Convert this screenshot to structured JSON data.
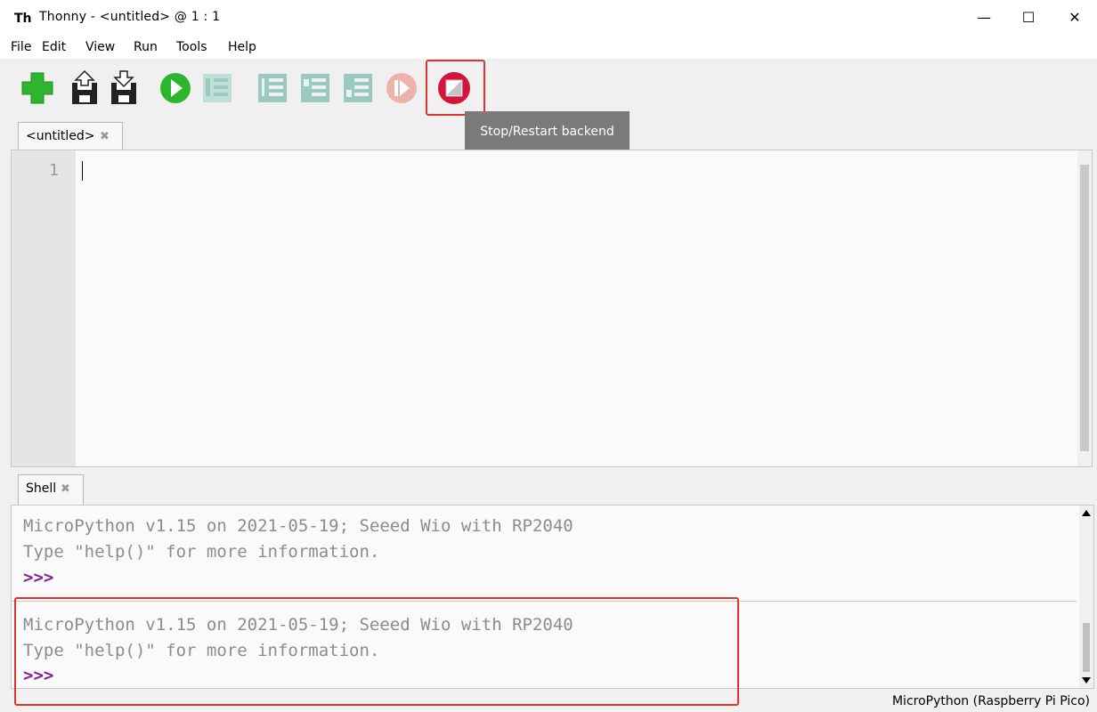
{
  "window": {
    "icon": "Th",
    "title": "Thonny  -  <untitled>  @  1 : 1",
    "minimize": "—",
    "maximize": "☐",
    "close": "✕"
  },
  "menu": {
    "items": [
      "File",
      "Edit",
      "View",
      "Run",
      "Tools",
      "Help"
    ]
  },
  "toolbar": {
    "buttons": [
      "new-file",
      "load-file",
      "save-file",
      "run",
      "debug",
      "step-over",
      "step-into",
      "step-out",
      "resume",
      "stop-restart"
    ],
    "tooltip": "Stop/Restart backend",
    "colors": {
      "green": "#2db52d",
      "stop_red": "#d6133a",
      "disabled": "#9bc8c0",
      "highlight": "#e5322d"
    }
  },
  "editor": {
    "tab_label": "<untitled>",
    "tab_close": "✖",
    "line_numbers": [
      "1"
    ]
  },
  "shell": {
    "tab_label": "Shell",
    "tab_close": "✖",
    "blocks": [
      {
        "line1": "MicroPython v1.15 on 2021-05-19; Seeed Wio with RP2040",
        "line2": "Type \"help()\" for more information.",
        "prompt": ">>>"
      },
      {
        "line1": "MicroPython v1.15 on 2021-05-19; Seeed Wio with RP2040",
        "line2": "Type \"help()\" for more information.",
        "prompt": ">>>"
      }
    ]
  },
  "status": {
    "interpreter": "MicroPython (Raspberry Pi Pico)"
  }
}
